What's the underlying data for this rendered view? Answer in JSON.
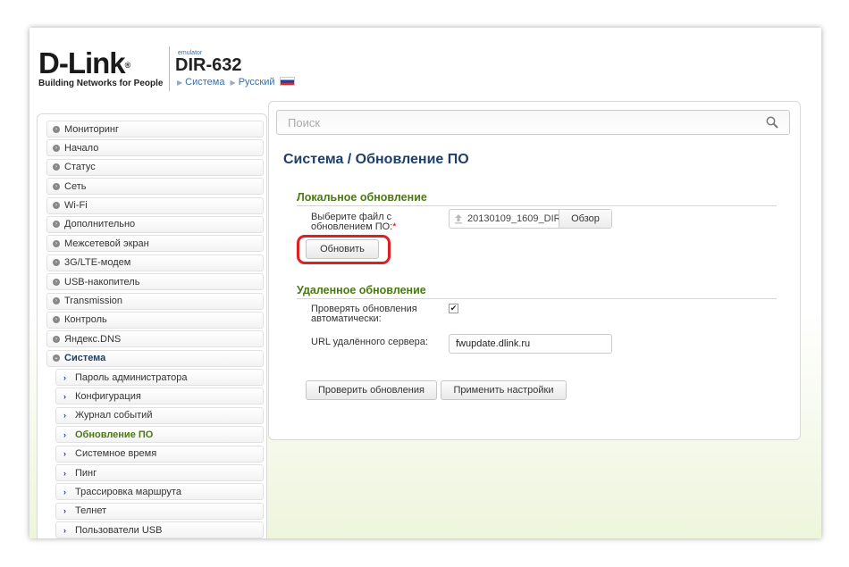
{
  "header": {
    "logo": "D-Link",
    "tagline": "Building Networks for People",
    "emulator": "emulator",
    "model": "DIR-632",
    "crumb_section": "Система",
    "crumb_language": "Русский"
  },
  "sidebar": {
    "items": [
      {
        "label": "Мониторинг"
      },
      {
        "label": "Начало"
      },
      {
        "label": "Статус"
      },
      {
        "label": "Сеть"
      },
      {
        "label": "Wi-Fi"
      },
      {
        "label": "Дополнительно"
      },
      {
        "label": "Межсетевой экран"
      },
      {
        "label": "3G/LTE-модем"
      },
      {
        "label": "USB-накопитель"
      },
      {
        "label": "Transmission"
      },
      {
        "label": "Контроль"
      },
      {
        "label": "Яндекс.DNS"
      },
      {
        "label": "Система"
      }
    ],
    "subitems": [
      {
        "label": "Пароль администратора"
      },
      {
        "label": "Конфигурация"
      },
      {
        "label": "Журнал событий"
      },
      {
        "label": "Обновление ПО"
      },
      {
        "label": "Системное время"
      },
      {
        "label": "Пинг"
      },
      {
        "label": "Трассировка маршрута"
      },
      {
        "label": "Телнет"
      },
      {
        "label": "Пользователи USB"
      }
    ]
  },
  "search": {
    "placeholder": "Поиск"
  },
  "page": {
    "title": "Система /  Обновление ПО",
    "local": {
      "heading": "Локальное обновление",
      "file_label_line1": "Выберите файл с",
      "file_label_line2": "обновлением ПО:",
      "required_mark": "*",
      "file_name": "20130109_1609_DIR",
      "browse_label": "Обзор",
      "update_button": "Обновить"
    },
    "remote": {
      "heading": "Удаленное обновление",
      "auto_check_line1": "Проверять обновления",
      "auto_check_line2": "автоматически:",
      "auto_check_checked": true,
      "url_label": "URL удалённого сервера:",
      "url_value": "fwupdate.dlink.ru",
      "check_button": "Проверить обновления",
      "apply_button": "Применить настройки"
    }
  },
  "colors": {
    "accent_green": "#4a7a10",
    "title_blue": "#1f3f6a",
    "highlight_red": "#e02020"
  }
}
